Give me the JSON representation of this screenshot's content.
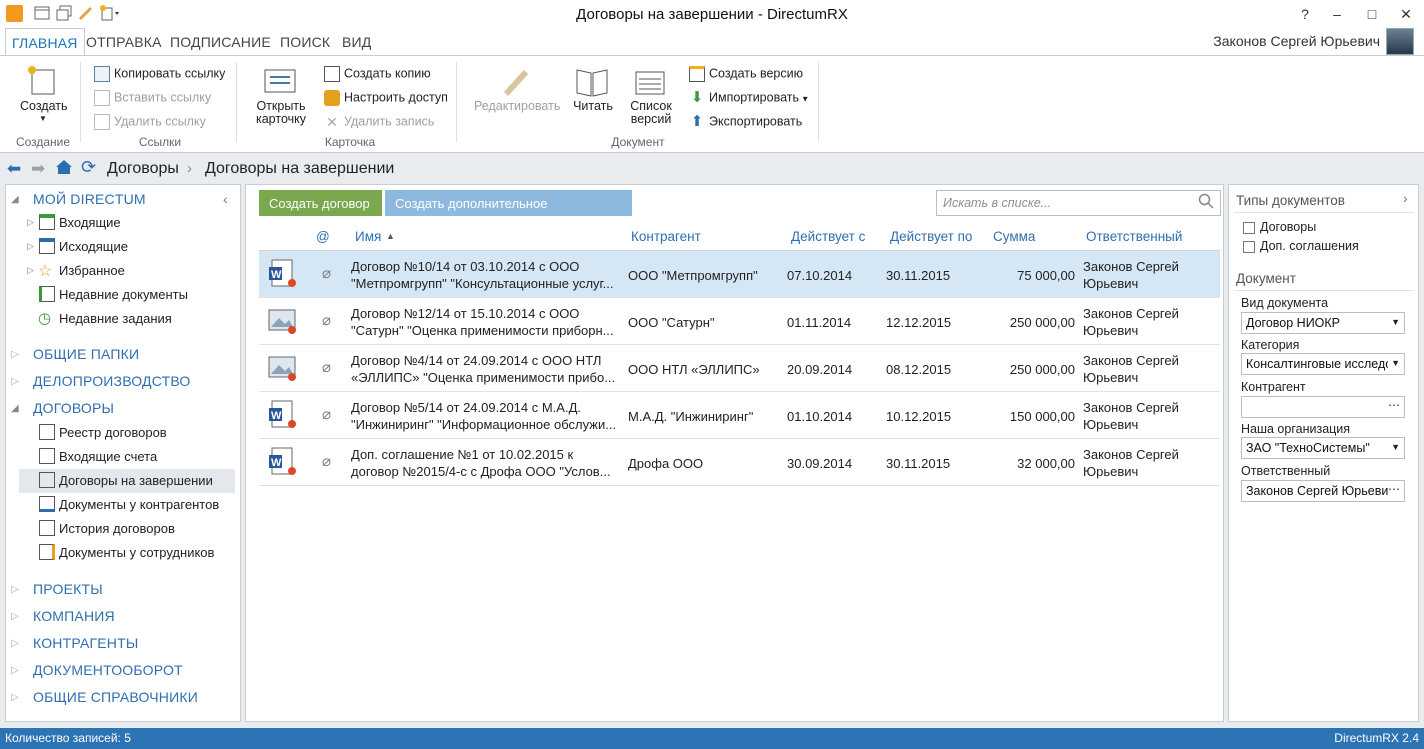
{
  "window": {
    "title": "Договоры на завершении - DirectumRX",
    "help": "?",
    "minimize": "–",
    "maximize": "□",
    "close": "✕"
  },
  "tabs": [
    "ГЛАВНАЯ",
    "ОТПРАВКА",
    "ПОДПИСАНИЕ",
    "ПОИСК",
    "ВИД"
  ],
  "user": "Законов Сергей Юрьевич",
  "ribbon": {
    "create": "Создать",
    "create_group": "Создание",
    "copy_link": "Копировать ссылку",
    "paste_link": "Вставить ссылку",
    "delete_link": "Удалить ссылку",
    "links_group": "Ссылки",
    "open_card": "Открыть карточку",
    "create_copy": "Создать копию",
    "access": "Настроить доступ",
    "delete_record": "Удалить запись",
    "card_group": "Карточка",
    "edit": "Редактировать",
    "read": "Читать",
    "versions": "Список версий",
    "create_version": "Создать версию",
    "import": "Импортировать",
    "export": "Экспортировать",
    "document_group": "Документ"
  },
  "breadcrumb": {
    "parent": "Договоры",
    "current": "Договоры на завершении"
  },
  "nav": {
    "my": "МОЙ DIRECTUM",
    "my_items": [
      "Входящие",
      "Исходящие",
      "Избранное",
      "Недавние документы",
      "Недавние задания"
    ],
    "common": "ОБЩИЕ ПАПКИ",
    "office": "ДЕЛОПРОИЗВОДСТВО",
    "contracts": "ДОГОВОРЫ",
    "contract_items": [
      "Реестр договоров",
      "Входящие счета",
      "Договоры на завершении",
      "Документы у контрагентов",
      "История договоров",
      "Документы у сотрудников"
    ],
    "bottom": [
      "ПРОЕКТЫ",
      "КОМПАНИЯ",
      "КОНТРАГЕНТЫ",
      "ДОКУМЕНТООБОРОТ",
      "ОБЩИЕ СПРАВОЧНИКИ"
    ]
  },
  "actions": {
    "create_contract": "Создать договор",
    "create_supplement": "Создать дополнительное соглашение",
    "search_placeholder": "Искать в списке..."
  },
  "columns": [
    "@",
    "Имя",
    "Контрагент",
    "Действует с",
    "Действует по",
    "Сумма",
    "Ответственный"
  ],
  "rows": [
    {
      "name1": "Договор №10/14 от 03.10.2014 с ООО",
      "name2": "\"Метпромгрупп\" \"Консультационные услуг...",
      "counterparty": "ООО \"Метпромгрупп\"",
      "from": "07.10.2014",
      "to": "30.11.2015",
      "sum": "75 000,00",
      "resp1": "Законов Сергей",
      "resp2": "Юрьевич",
      "icon": "word"
    },
    {
      "name1": "Договор №12/14 от 15.10.2014 с ООО",
      "name2": "\"Сатурн\" \"Оценка применимости приборн...",
      "counterparty": "ООО \"Сатурн\"",
      "from": "01.11.2014",
      "to": "12.12.2015",
      "sum": "250 000,00",
      "resp1": "Законов Сергей",
      "resp2": "Юрьевич",
      "icon": "image"
    },
    {
      "name1": "Договор №4/14 от 24.09.2014 с ООО НТЛ",
      "name2": "«ЭЛЛИПС» \"Оценка применимости прибо...",
      "counterparty": "ООО НТЛ «ЭЛЛИПС»",
      "from": "20.09.2014",
      "to": "08.12.2015",
      "sum": "250 000,00",
      "resp1": "Законов Сергей",
      "resp2": "Юрьевич",
      "icon": "image"
    },
    {
      "name1": "Договор №5/14 от 24.09.2014 с М.А.Д.",
      "name2": "\"Инжиниринг\" \"Информационное обслужи...",
      "counterparty": "М.А.Д. \"Инжиниринг\"",
      "from": "01.10.2014",
      "to": "10.12.2015",
      "sum": "150 000,00",
      "resp1": "Законов Сергей",
      "resp2": "Юрьевич",
      "icon": "word"
    },
    {
      "name1": "Доп. соглашение №1 от 10.02.2015 к",
      "name2": "договор №2015/4-с с Дрофа ООО \"Услов...",
      "counterparty": "Дрофа ООО",
      "from": "30.09.2014",
      "to": "30.11.2015",
      "sum": "32 000,00",
      "resp1": "Законов Сергей",
      "resp2": "Юрьевич",
      "icon": "word"
    }
  ],
  "filters": {
    "doc_types": "Типы документов",
    "opt1": "Договоры",
    "opt2": "Доп. соглашения",
    "document": "Документ",
    "kind_label": "Вид документа",
    "kind": "Договор НИОКР",
    "category_label": "Категория",
    "category": "Консалтинговые исследо",
    "counterparty_label": "Контрагент",
    "counterparty": "",
    "org_label": "Наша организация",
    "org": "ЗАО \"ТехноСистемы\"",
    "resp_label": "Ответственный",
    "resp": "Законов Сергей Юрьевич"
  },
  "status": {
    "count": "Количество записей: 5",
    "version": "DirectumRX 2.4"
  }
}
